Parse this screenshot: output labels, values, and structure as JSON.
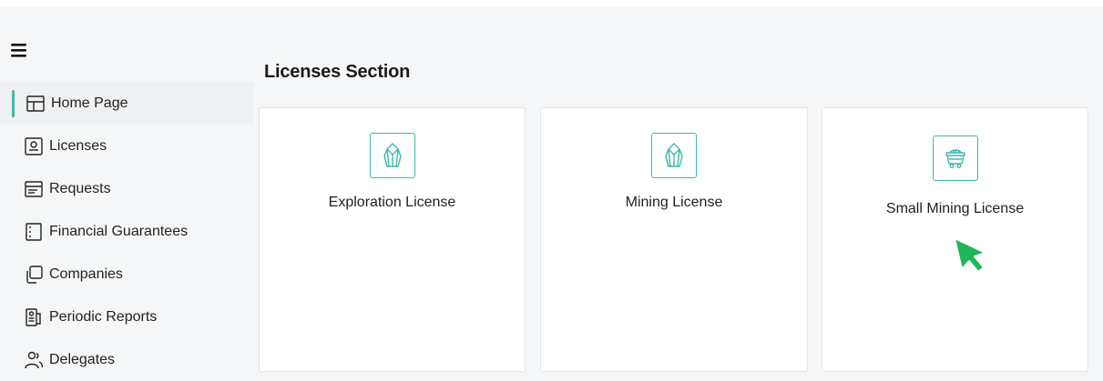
{
  "sidebar": {
    "items": [
      {
        "label": "Home Page",
        "icon": "layout-icon",
        "active": true
      },
      {
        "label": "Licenses",
        "icon": "license-card-icon"
      },
      {
        "label": "Requests",
        "icon": "document-icon"
      },
      {
        "label": "Financial Guarantees",
        "icon": "notebook-icon"
      },
      {
        "label": "Companies",
        "icon": "copy-icon"
      },
      {
        "label": "Periodic Reports",
        "icon": "reports-icon"
      },
      {
        "label": "Delegates",
        "icon": "users-icon"
      }
    ]
  },
  "main": {
    "title": "Licenses Section",
    "cards": [
      {
        "label": "Exploration License",
        "icon": "crystal-icon"
      },
      {
        "label": "Mining License",
        "icon": "crystal-icon"
      },
      {
        "label": "Small Mining License",
        "icon": "mine-cart-icon"
      }
    ]
  },
  "colors": {
    "accent": "#3fb9a6",
    "cursor": "#1fb65a",
    "background": "#f4f6f7",
    "card": "#ffffff"
  }
}
